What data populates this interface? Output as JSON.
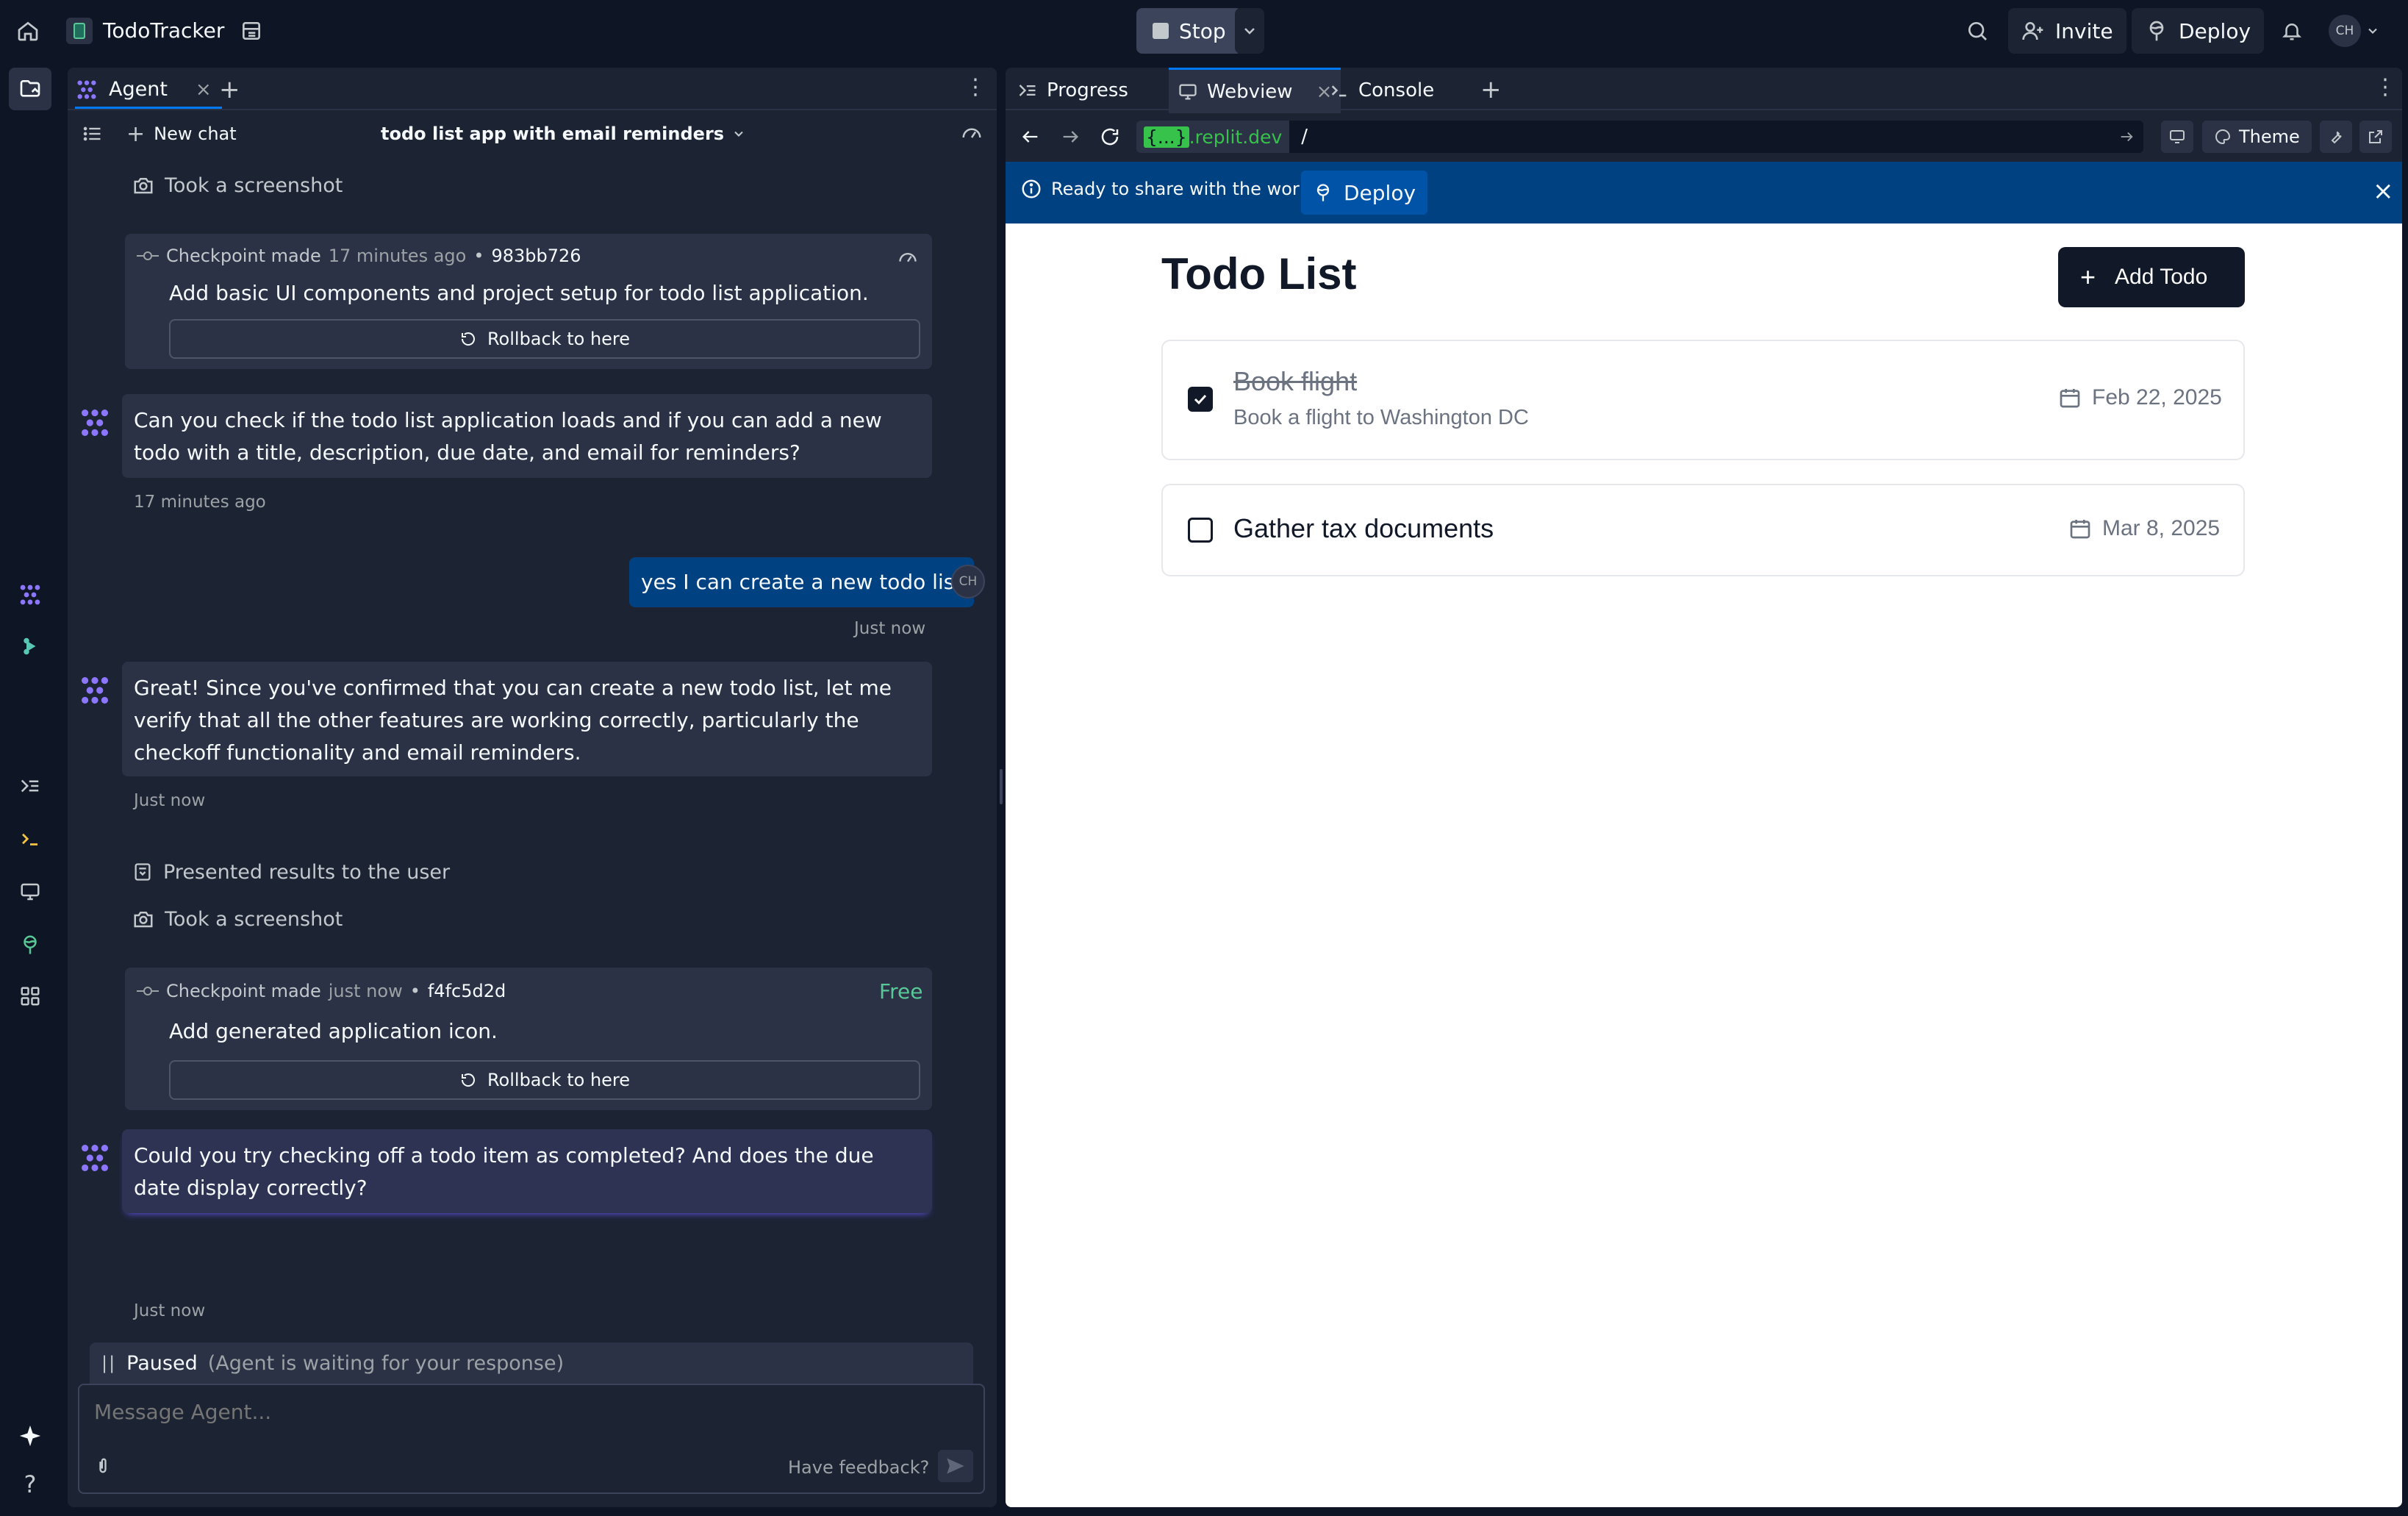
{
  "topbar": {
    "app_name": "TodoTracker",
    "stop_label": "Stop",
    "invite_label": "Invite",
    "deploy_label": "Deploy",
    "avatar_initials": "CH"
  },
  "agent": {
    "tab_label": "Agent",
    "new_chat_label": "New chat",
    "chat_title": "todo list app with email reminders",
    "messages": {
      "took_screenshot_1": "Took a screenshot",
      "checkpoint1": {
        "label": "Checkpoint made",
        "time": "17 minutes ago",
        "sep": "•",
        "hash": "983bb726",
        "desc": "Add basic UI components and project setup for todo list application.",
        "rollback": "Rollback to here"
      },
      "agent_msg1": "Can you check if the todo list application loads and if you can add a new todo with a title, description, due date, and email for reminders?",
      "agent_msg1_time": "17 minutes ago",
      "user_msg": "yes I can create a new todo list",
      "user_msg_time": "Just now",
      "user_initials": "CH",
      "agent_msg2": "Great! Since you've confirmed that you can create a new todo list, let me verify that all the other features are working correctly, particularly the checkoff functionality and email reminders.",
      "agent_msg2_time": "Just now",
      "presented_results": "Presented results to the user",
      "took_screenshot_2": "Took a screenshot",
      "checkpoint2": {
        "label": "Checkpoint made",
        "time": "just now",
        "sep": "•",
        "hash": "f4fc5d2d",
        "badge": "Free",
        "desc": "Add generated application icon.",
        "rollback": "Rollback to here"
      },
      "agent_msg3": "Could you try checking off a todo item as completed? And does the due date display correctly?",
      "agent_msg3_time": "Just now"
    },
    "paused_label": "Paused",
    "paused_detail": "(Agent is waiting for your response)",
    "input_placeholder": "Message Agent...",
    "feedback_label": "Have feedback?"
  },
  "right": {
    "tabs": {
      "progress": "Progress",
      "webview": "Webview",
      "console": "Console"
    },
    "url_domain_prefix": "{...}",
    "url_domain": ".replit.dev",
    "url_path": "/",
    "theme_label": "Theme",
    "banner_text": "Ready to share with the world?",
    "banner_deploy": "Deploy"
  },
  "app": {
    "title": "Todo List",
    "add_button": "Add Todo",
    "todos": [
      {
        "title": "Book flight",
        "description": "Book a flight to Washington DC",
        "date": "Feb 22, 2025",
        "done": true
      },
      {
        "title": "Gather tax documents",
        "description": "",
        "date": "Mar 8, 2025",
        "done": false
      }
    ]
  },
  "colors": {
    "accent_blue": "#0053a6",
    "banner_bg": "#004182",
    "free_green": "#58c896",
    "url_green": "#36c24b"
  }
}
